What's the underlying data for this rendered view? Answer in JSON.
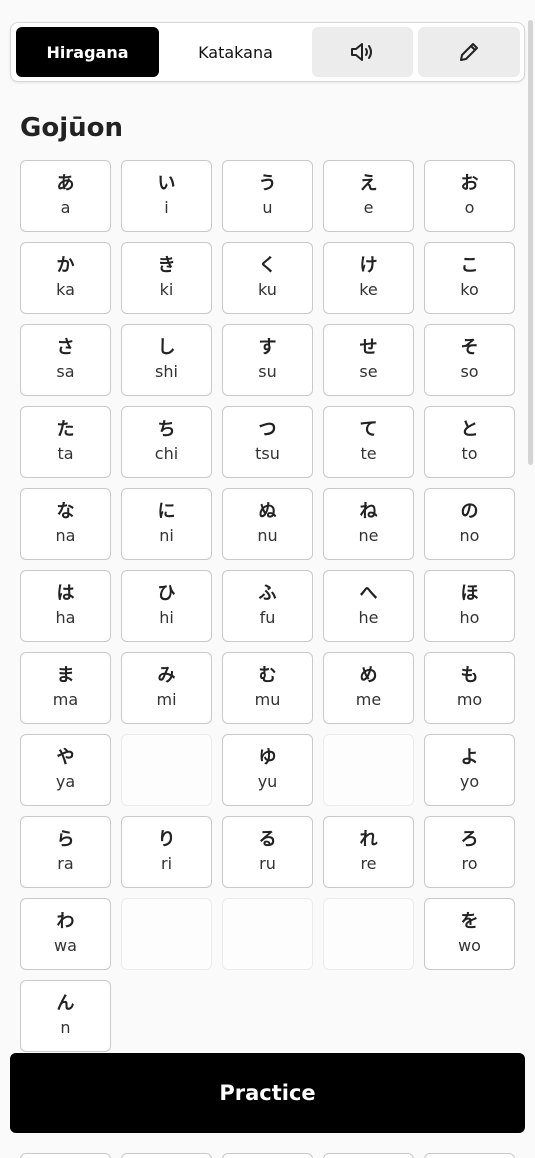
{
  "toolbar": {
    "hiragana_label": "Hiragana",
    "katakana_label": "Katakana",
    "sound_icon": "speaker-icon",
    "edit_icon": "pencil-icon"
  },
  "section": {
    "title": "Gojūon"
  },
  "grid": [
    [
      {
        "kana": "あ",
        "romaji": "a"
      },
      {
        "kana": "い",
        "romaji": "i"
      },
      {
        "kana": "う",
        "romaji": "u"
      },
      {
        "kana": "え",
        "romaji": "e"
      },
      {
        "kana": "お",
        "romaji": "o"
      }
    ],
    [
      {
        "kana": "か",
        "romaji": "ka"
      },
      {
        "kana": "き",
        "romaji": "ki"
      },
      {
        "kana": "く",
        "romaji": "ku"
      },
      {
        "kana": "け",
        "romaji": "ke"
      },
      {
        "kana": "こ",
        "romaji": "ko"
      }
    ],
    [
      {
        "kana": "さ",
        "romaji": "sa"
      },
      {
        "kana": "し",
        "romaji": "shi"
      },
      {
        "kana": "す",
        "romaji": "su"
      },
      {
        "kana": "せ",
        "romaji": "se"
      },
      {
        "kana": "そ",
        "romaji": "so"
      }
    ],
    [
      {
        "kana": "た",
        "romaji": "ta"
      },
      {
        "kana": "ち",
        "romaji": "chi"
      },
      {
        "kana": "つ",
        "romaji": "tsu"
      },
      {
        "kana": "て",
        "romaji": "te"
      },
      {
        "kana": "と",
        "romaji": "to"
      }
    ],
    [
      {
        "kana": "な",
        "romaji": "na"
      },
      {
        "kana": "に",
        "romaji": "ni"
      },
      {
        "kana": "ぬ",
        "romaji": "nu"
      },
      {
        "kana": "ね",
        "romaji": "ne"
      },
      {
        "kana": "の",
        "romaji": "no"
      }
    ],
    [
      {
        "kana": "は",
        "romaji": "ha"
      },
      {
        "kana": "ひ",
        "romaji": "hi"
      },
      {
        "kana": "ふ",
        "romaji": "fu"
      },
      {
        "kana": "へ",
        "romaji": "he"
      },
      {
        "kana": "ほ",
        "romaji": "ho"
      }
    ],
    [
      {
        "kana": "ま",
        "romaji": "ma"
      },
      {
        "kana": "み",
        "romaji": "mi"
      },
      {
        "kana": "む",
        "romaji": "mu"
      },
      {
        "kana": "め",
        "romaji": "me"
      },
      {
        "kana": "も",
        "romaji": "mo"
      }
    ],
    [
      {
        "kana": "や",
        "romaji": "ya"
      },
      null,
      {
        "kana": "ゆ",
        "romaji": "yu"
      },
      null,
      {
        "kana": "よ",
        "romaji": "yo"
      }
    ],
    [
      {
        "kana": "ら",
        "romaji": "ra"
      },
      {
        "kana": "り",
        "romaji": "ri"
      },
      {
        "kana": "る",
        "romaji": "ru"
      },
      {
        "kana": "れ",
        "romaji": "re"
      },
      {
        "kana": "ろ",
        "romaji": "ro"
      }
    ],
    [
      {
        "kana": "わ",
        "romaji": "wa"
      },
      null,
      null,
      null,
      {
        "kana": "を",
        "romaji": "wo"
      }
    ],
    [
      {
        "kana": "ん",
        "romaji": "n"
      }
    ]
  ],
  "practice": {
    "label": "Practice"
  },
  "colors": {
    "active": "#000000",
    "background": "#fafafa",
    "border": "#c9c9c9"
  }
}
